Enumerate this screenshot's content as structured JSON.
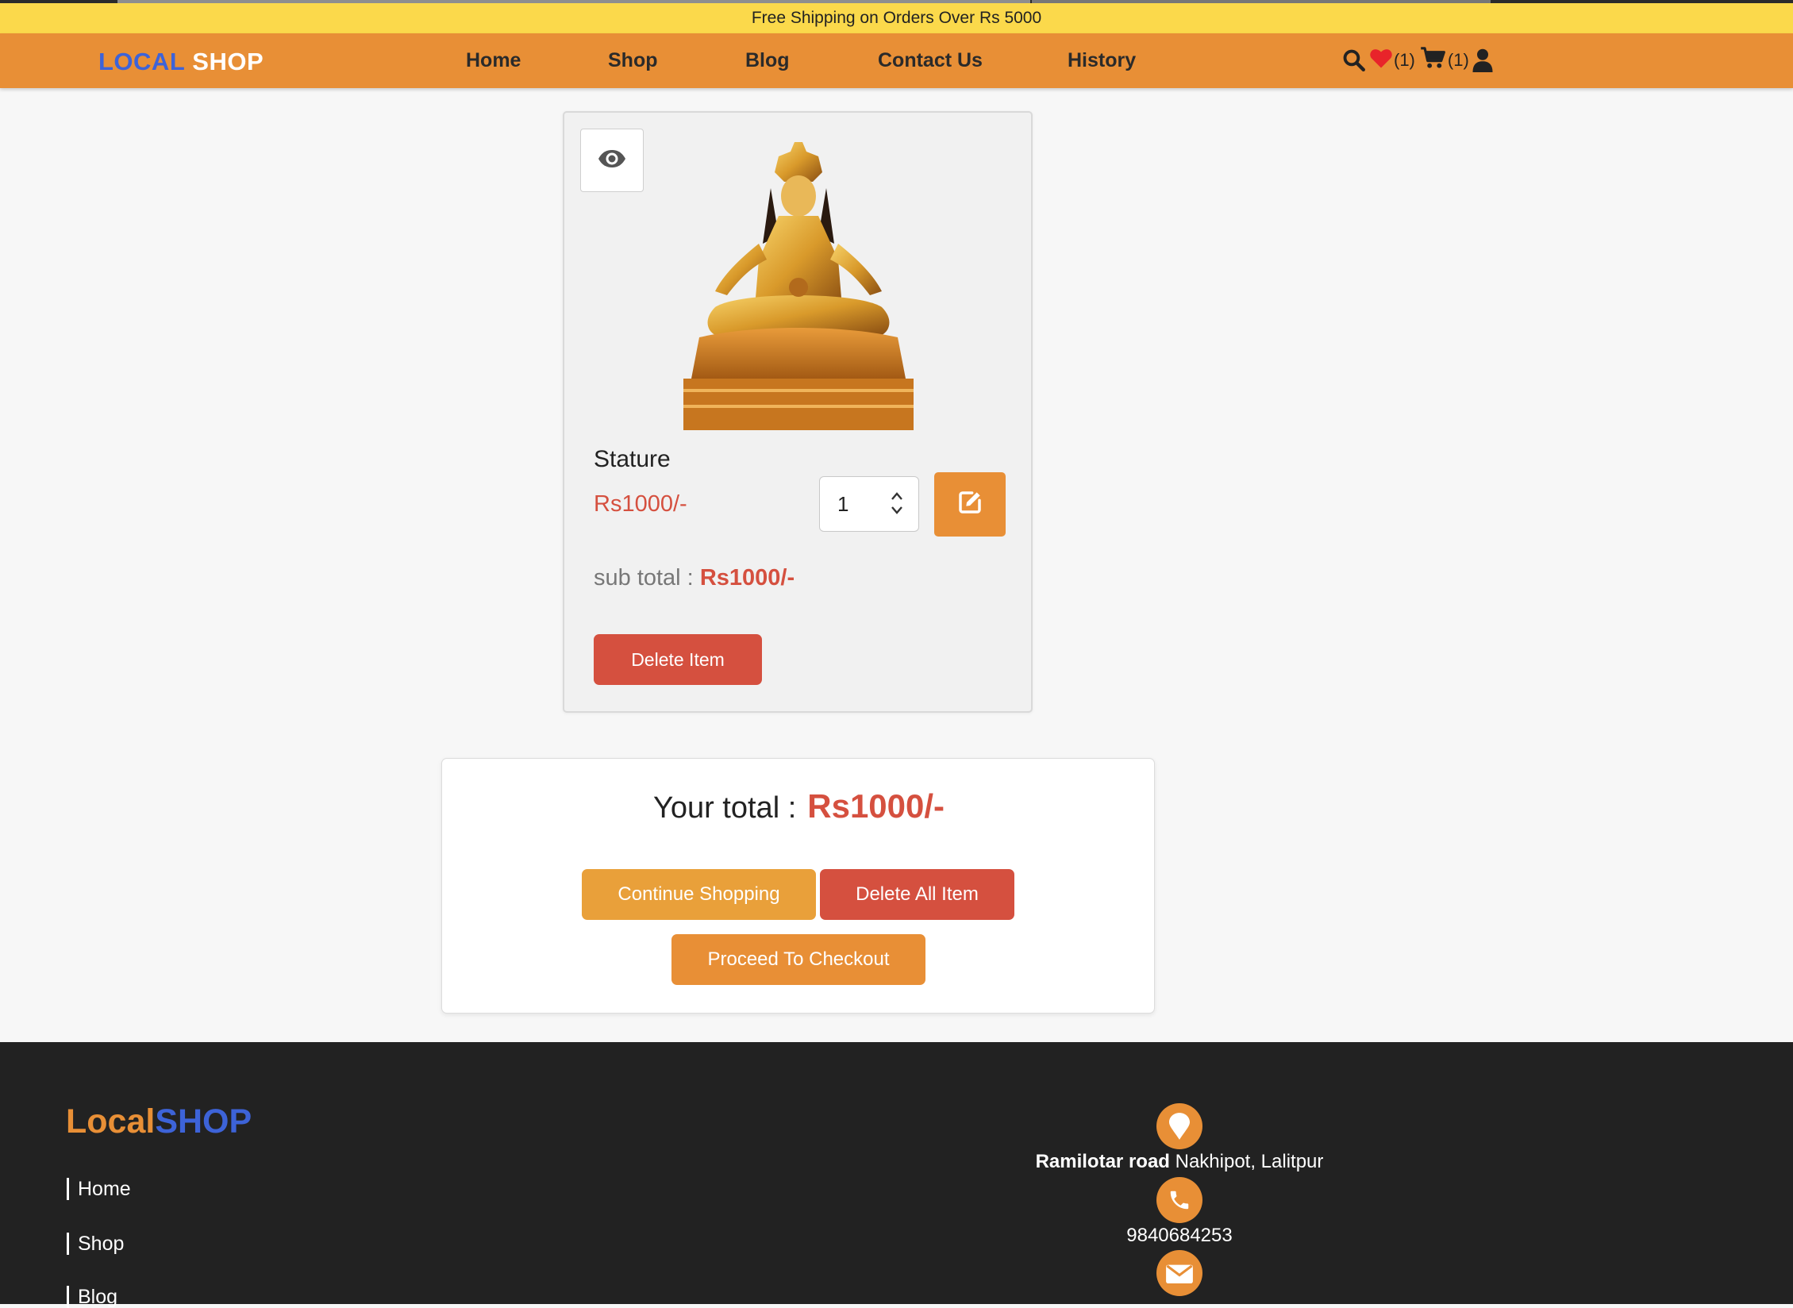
{
  "promo": {
    "text": "Free Shipping on Orders Over Rs 5000"
  },
  "header": {
    "logo_part1": "LOCAL",
    "logo_part2": "SHOP",
    "nav": {
      "home": "Home",
      "shop": "Shop",
      "blog": "Blog",
      "contact": "Contact Us",
      "history": "History"
    },
    "wishlist_count": "(1)",
    "cart_count": "(1)"
  },
  "cart_item": {
    "name": "Stature",
    "price": "Rs1000/-",
    "quantity": "1",
    "subtotal_label": "sub total :",
    "subtotal_value": "Rs1000/-",
    "delete_label": "Delete Item"
  },
  "summary": {
    "total_label": "Your total :",
    "total_value": "Rs1000/-",
    "continue_label": "Continue Shopping",
    "delete_all_label": "Delete All Item",
    "checkout_label": "Proceed To Checkout"
  },
  "footer": {
    "logo_part1": "Local",
    "logo_part2": "SHOP",
    "links": {
      "home": "Home",
      "shop": "Shop",
      "blog": "Blog"
    },
    "address_bold": "Ramilotar road",
    "address_rest": "Nakhipot, Lalitpur",
    "phone": "9840684253"
  },
  "colors": {
    "promo_bar": "#fbd94b",
    "nav_orange": "#e88f36",
    "brand_blue": "#3d63d8",
    "price_red": "#d5503f",
    "footer_bg": "#222222"
  },
  "icons": [
    "search-icon",
    "heart-icon",
    "cart-icon",
    "user-icon",
    "eye-icon",
    "edit-icon",
    "map-pin-icon",
    "phone-icon",
    "envelope-icon"
  ]
}
